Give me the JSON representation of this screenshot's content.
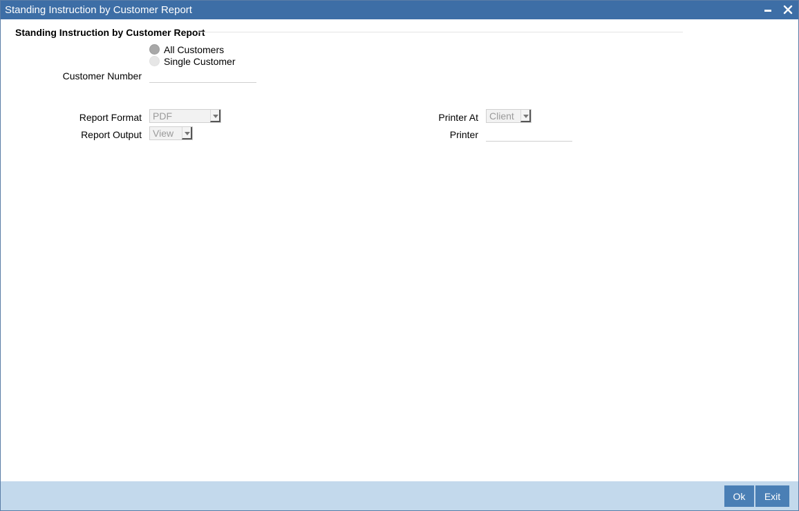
{
  "window": {
    "title": "Standing Instruction by Customer Report"
  },
  "form": {
    "section_title": "Standing Instruction by Customer Report",
    "radio_all_customers": "All Customers",
    "radio_single_customer": "Single Customer",
    "customer_number_label": "Customer Number",
    "customer_number_value": "",
    "report_format_label": "Report Format",
    "report_format_value": "PDF",
    "report_output_label": "Report Output",
    "report_output_value": "View",
    "printer_at_label": "Printer At",
    "printer_at_value": "Client",
    "printer_label": "Printer",
    "printer_value": ""
  },
  "footer": {
    "ok_label": "Ok",
    "exit_label": "Exit"
  },
  "colors": {
    "titlebar": "#3d6ea6",
    "footer": "#c3d9ec",
    "button": "#4a7fb5"
  },
  "icons": {
    "minimize": "minimize-icon",
    "close": "close-icon",
    "dropdown": "chevron-down-icon"
  }
}
